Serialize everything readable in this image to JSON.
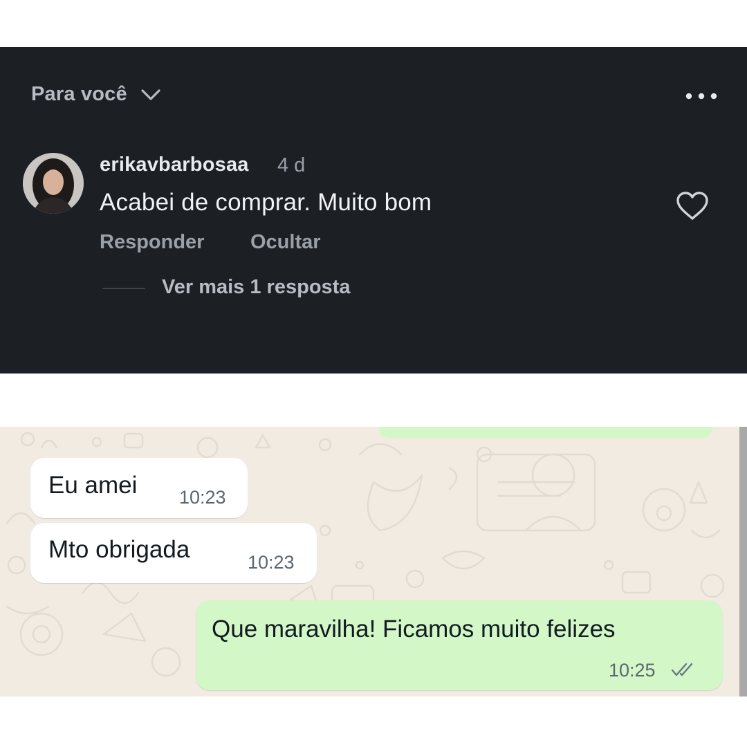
{
  "comments": {
    "sort": {
      "label": "Para você",
      "icon": "chevron-down-icon"
    },
    "more_icon": "more-horizontal-icon",
    "comment": {
      "username": "erikavbarbosaa",
      "time_ago": "4 d",
      "text": "Acabei de comprar. Muito bom",
      "like_icon": "heart-outline-icon",
      "actions": {
        "reply": "Responder",
        "hide": "Ocultar"
      },
      "replies_link": "Ver mais 1 resposta"
    },
    "colors": {
      "background": "#1c1f24",
      "primary_text": "#f1f2f4",
      "muted_text": "#9aa0a8"
    }
  },
  "chat": {
    "messages": [
      {
        "direction": "incoming",
        "text": "Eu amei",
        "time": "10:23"
      },
      {
        "direction": "incoming",
        "text": "Mto obrigada",
        "time": "10:23"
      },
      {
        "direction": "outgoing",
        "text": "Que maravilha! Ficamos muito felizes",
        "time": "10:25",
        "status": "read"
      }
    ],
    "colors": {
      "wallpaper": "#f1ebe2",
      "incoming_bubble": "#ffffff",
      "outgoing_bubble": "#d4f7c7"
    }
  }
}
